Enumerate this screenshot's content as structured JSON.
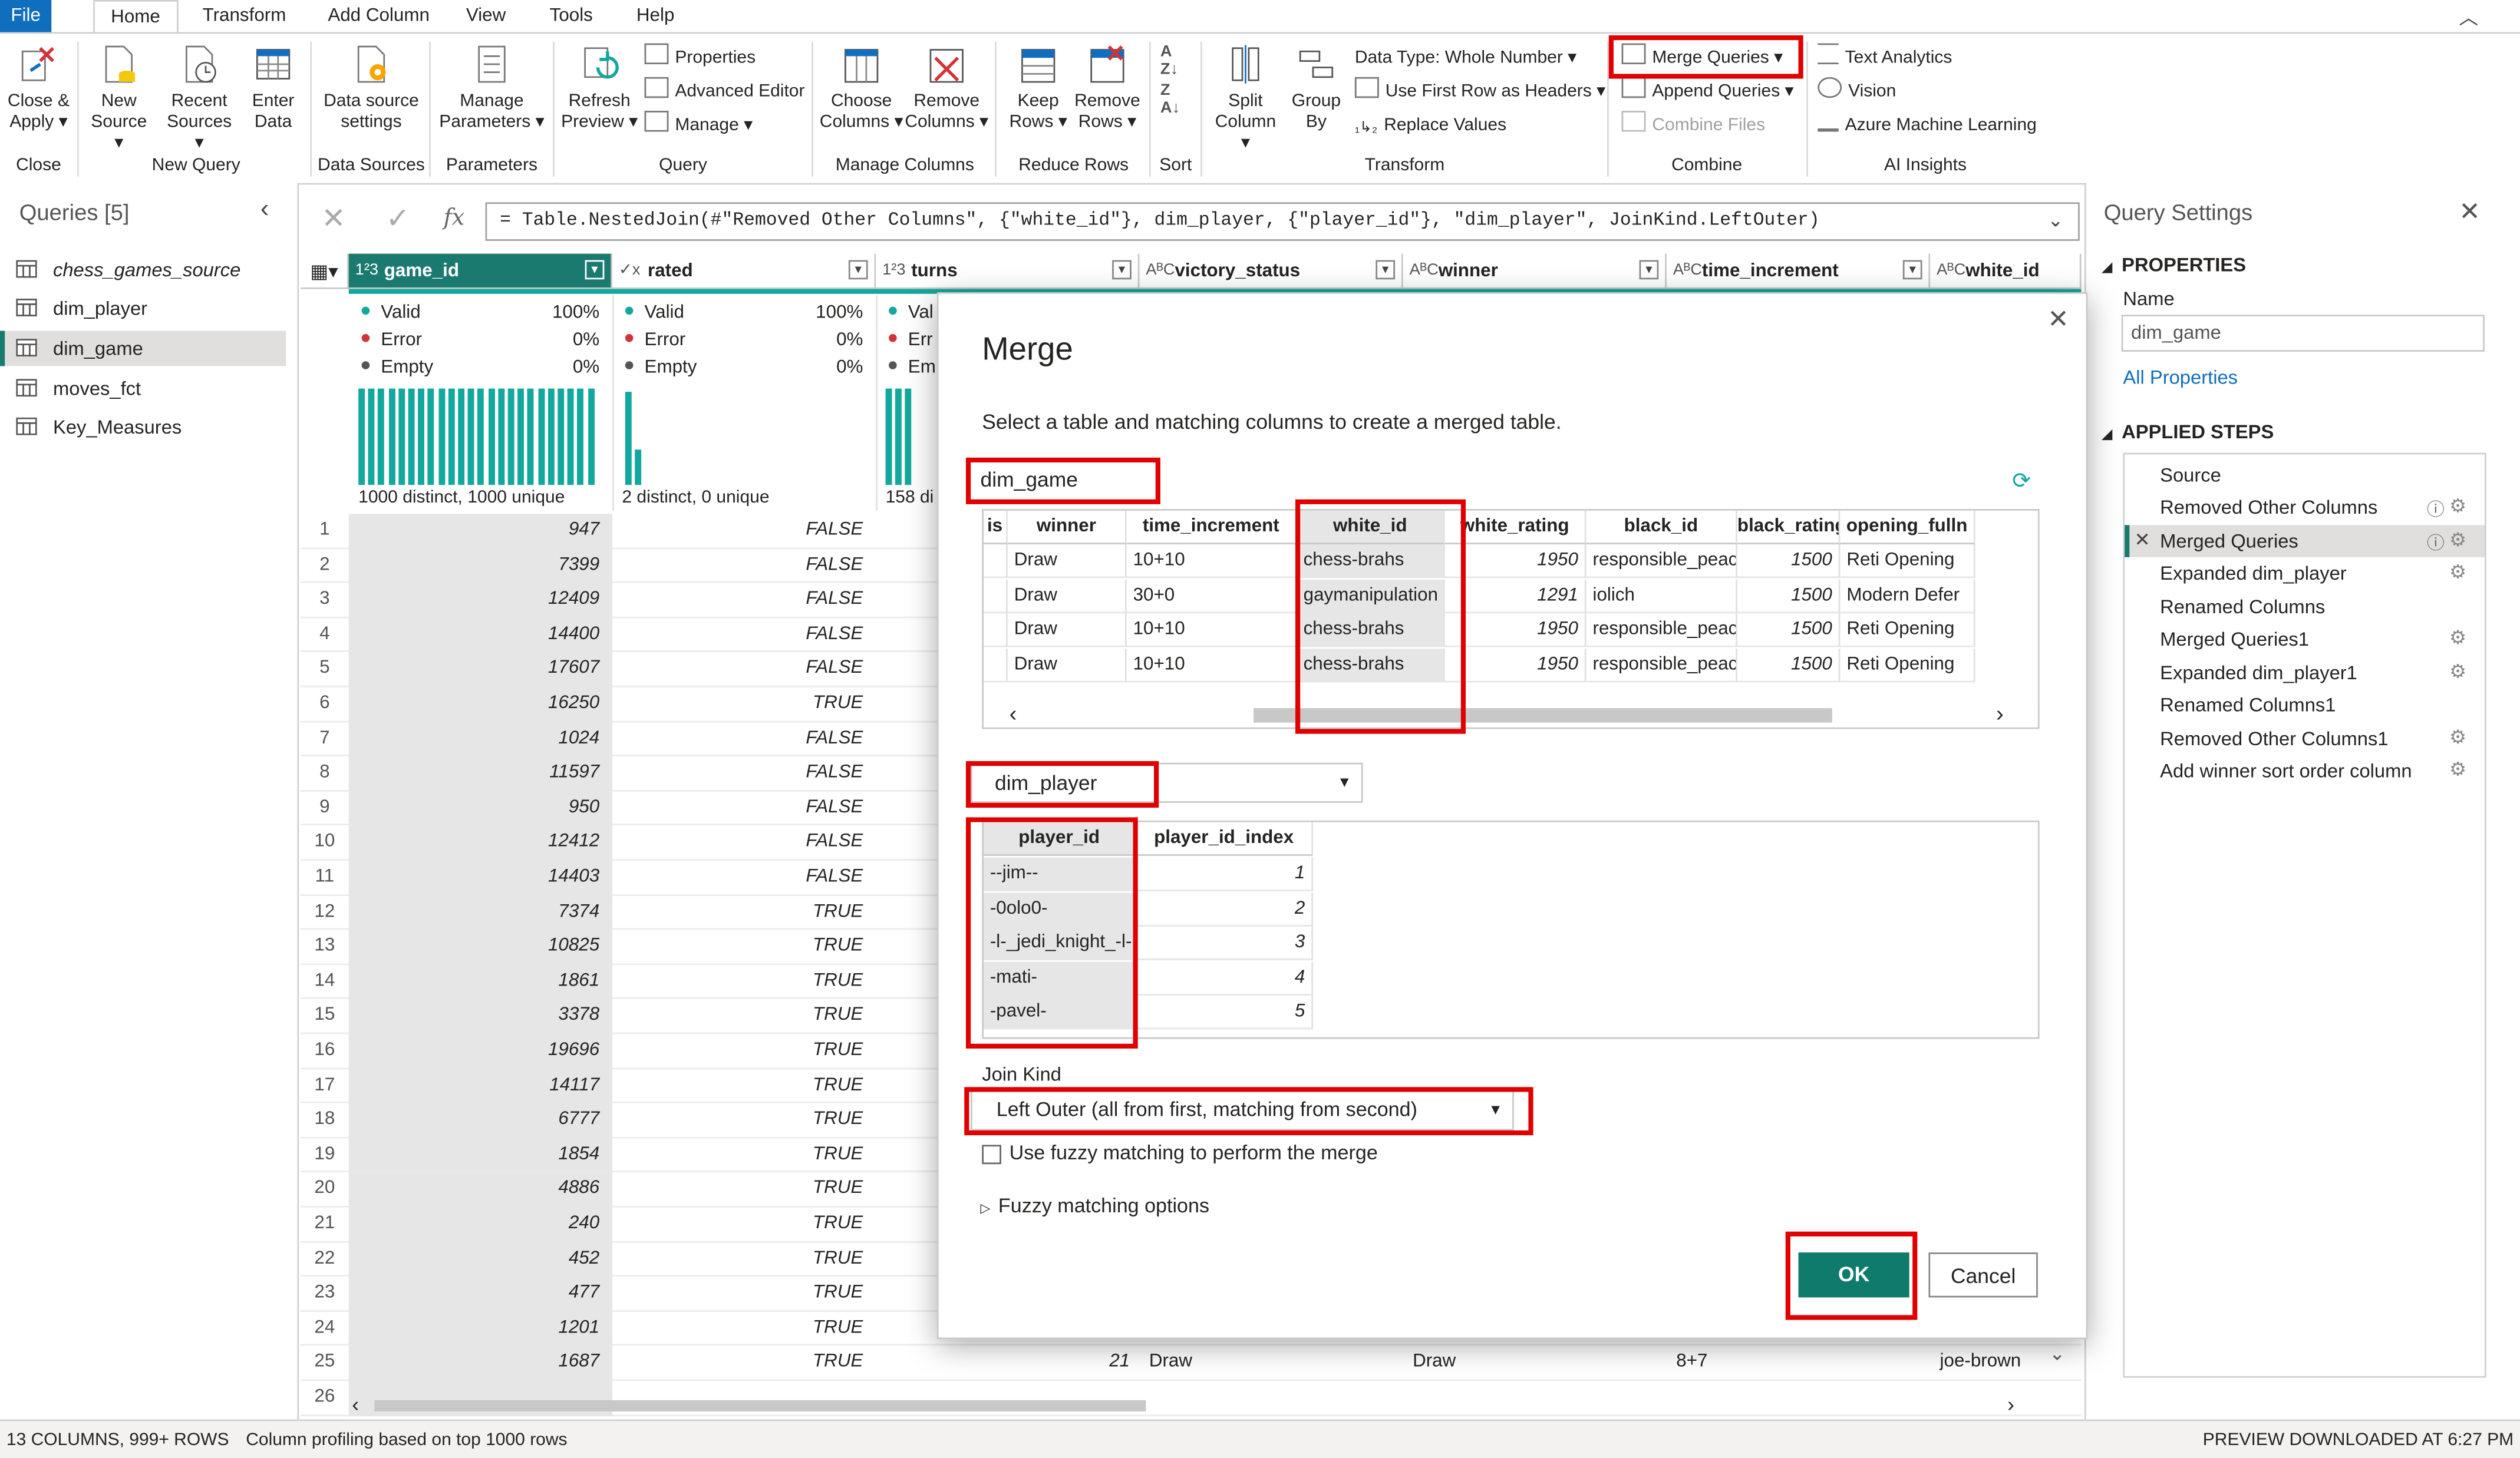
{
  "tabs": [
    "File",
    "Home",
    "Transform",
    "Add Column",
    "View",
    "Tools",
    "Help"
  ],
  "ribbon": {
    "close_apply": [
      "Close &",
      "Apply"
    ],
    "new_source": [
      "New",
      "Source"
    ],
    "recent_sources": [
      "Recent",
      "Sources"
    ],
    "enter_data": [
      "Enter",
      "Data"
    ],
    "data_source_settings": [
      "Data source",
      "settings"
    ],
    "manage_parameters": [
      "Manage",
      "Parameters"
    ],
    "refresh_preview": [
      "Refresh",
      "Preview"
    ],
    "properties": "Properties",
    "advanced_editor": "Advanced Editor",
    "manage": "Manage",
    "choose_columns": [
      "Choose",
      "Columns"
    ],
    "remove_columns": [
      "Remove",
      "Columns"
    ],
    "keep_rows": [
      "Keep",
      "Rows"
    ],
    "remove_rows": [
      "Remove",
      "Rows"
    ],
    "split_column": [
      "Split",
      "Column"
    ],
    "group_by": [
      "Group",
      "By"
    ],
    "data_type": "Data Type: Whole Number",
    "use_first_row": "Use First Row as Headers",
    "replace_values": "Replace Values",
    "merge_queries": "Merge Queries",
    "append_queries": "Append Queries",
    "combine_files": "Combine Files",
    "text_analytics": "Text Analytics",
    "vision": "Vision",
    "azure_ml": "Azure Machine Learning",
    "groups": [
      "Close",
      "New Query",
      "Data Sources",
      "Parameters",
      "Query",
      "Manage Columns",
      "Reduce Rows",
      "Sort",
      "Transform",
      "Combine",
      "AI Insights"
    ]
  },
  "queries": {
    "title": "Queries [5]",
    "items": [
      "chess_games_source",
      "dim_player",
      "dim_game",
      "moves_fct",
      "Key_Measures"
    ]
  },
  "formula": {
    "fx": "fx",
    "text": "= Table.NestedJoin(#\"Removed Other Columns\", {\"white_id\"}, dim_player, {\"player_id\"}, \"dim_player\", JoinKind.LeftOuter)"
  },
  "grid": {
    "columns": [
      {
        "type": "1²3",
        "name": "game_id"
      },
      {
        "type": "✓x",
        "name": "rated"
      },
      {
        "type": "1²3",
        "name": "turns"
      },
      {
        "type": "AᴮC",
        "name": "victory_status"
      },
      {
        "type": "AᴮC",
        "name": "winner"
      },
      {
        "type": "AᴮC",
        "name": "time_increment"
      },
      {
        "type": "AᴮC",
        "name": "white_id"
      }
    ],
    "quality": {
      "game_id": {
        "valid": "Valid",
        "valid_pct": "100%",
        "error": "Error",
        "error_pct": "0%",
        "empty": "Empty",
        "empty_pct": "0%",
        "distinct": "1000 distinct, 1000 unique"
      },
      "rated": {
        "valid": "Valid",
        "valid_pct": "100%",
        "error": "Error",
        "error_pct": "0%",
        "empty": "Empty",
        "empty_pct": "0%",
        "distinct": "2 distinct, 0 unique"
      },
      "turns": {
        "valid": "Val",
        "error": "Err",
        "empty": "Em",
        "distinct": "158 di"
      }
    },
    "row_numbers": [
      "1",
      "2",
      "3",
      "4",
      "5",
      "6",
      "7",
      "8",
      "9",
      "10",
      "11",
      "12",
      "13",
      "14",
      "15",
      "16",
      "17",
      "18",
      "19",
      "20",
      "21",
      "22",
      "23",
      "24",
      "25",
      "26"
    ],
    "game_ids": [
      "947",
      "7399",
      "12409",
      "14400",
      "17607",
      "16250",
      "1024",
      "11597",
      "950",
      "12412",
      "14403",
      "7374",
      "10825",
      "1861",
      "3378",
      "19696",
      "14117",
      "6777",
      "1854",
      "4886",
      "240",
      "452",
      "477",
      "1201",
      "1687",
      ""
    ],
    "rated": [
      "FALSE",
      "FALSE",
      "FALSE",
      "FALSE",
      "FALSE",
      "TRUE",
      "FALSE",
      "FALSE",
      "FALSE",
      "FALSE",
      "FALSE",
      "TRUE",
      "TRUE",
      "TRUE",
      "TRUE",
      "TRUE",
      "TRUE",
      "TRUE",
      "TRUE",
      "TRUE",
      "TRUE",
      "TRUE",
      "TRUE",
      "TRUE",
      "TRUE",
      ""
    ],
    "last_row": {
      "turns": "21",
      "victory_status": "Draw",
      "winner": "Draw",
      "time_increment": "8+7",
      "white_id": "joe-brown"
    }
  },
  "settings": {
    "title": "Query Settings",
    "properties": "PROPERTIES",
    "name_label": "Name",
    "name_value": "dim_game",
    "all_properties": "All Properties",
    "applied_steps": "APPLIED STEPS",
    "steps": [
      "Source",
      "Removed Other Columns",
      "Merged Queries",
      "Expanded dim_player",
      "Renamed Columns",
      "Merged Queries1",
      "Expanded dim_player1",
      "Renamed Columns1",
      "Removed Other Columns1",
      "Add winner sort order column"
    ]
  },
  "status": {
    "left": "13 COLUMNS, 999+ ROWS",
    "profiling": "Column profiling based on top 1000 rows",
    "right": "PREVIEW DOWNLOADED AT 6:27 PM"
  },
  "merge": {
    "title": "Merge",
    "subtitle": "Select a table and matching columns to create a merged table.",
    "first_table": "dim_game",
    "first_headers": [
      "is",
      "winner",
      "time_increment",
      "white_id",
      "white_rating",
      "black_id",
      "black_rating",
      "opening_fulln"
    ],
    "first_rows": [
      [
        "",
        "Draw",
        "10+10",
        "chess-brahs",
        "1950",
        "responsible_peach",
        "1500",
        "Reti Opening"
      ],
      [
        "",
        "Draw",
        "30+0",
        "gaymanipulation",
        "1291",
        "iolich",
        "1500",
        "Modern Defer"
      ],
      [
        "",
        "Draw",
        "10+10",
        "chess-brahs",
        "1950",
        "responsible_peach",
        "1500",
        "Reti Opening"
      ],
      [
        "",
        "Draw",
        "10+10",
        "chess-brahs",
        "1950",
        "responsible_peach",
        "1500",
        "Reti Opening"
      ]
    ],
    "second_table": "dim_player",
    "second_headers": [
      "player_id",
      "player_id_index"
    ],
    "second_rows": [
      [
        "--jim--",
        "1"
      ],
      [
        "-0olo0-",
        "2"
      ],
      [
        "-l-_jedi_knight_-l-",
        "3"
      ],
      [
        "-mati-",
        "4"
      ],
      [
        "-pavel-",
        "5"
      ]
    ],
    "join_kind_label": "Join Kind",
    "join_kind": "Left Outer (all from first, matching from second)",
    "fuzzy_checkbox": "Use fuzzy matching to perform the merge",
    "fuzzy_options": "Fuzzy matching options",
    "ok": "OK",
    "cancel": "Cancel"
  },
  "colors": {
    "accent": "#106ebe",
    "teal": "#13a89e",
    "header_teal": "#1b7a6f",
    "highlight_red": "#e00000",
    "ok_button": "#0f7b6c"
  }
}
